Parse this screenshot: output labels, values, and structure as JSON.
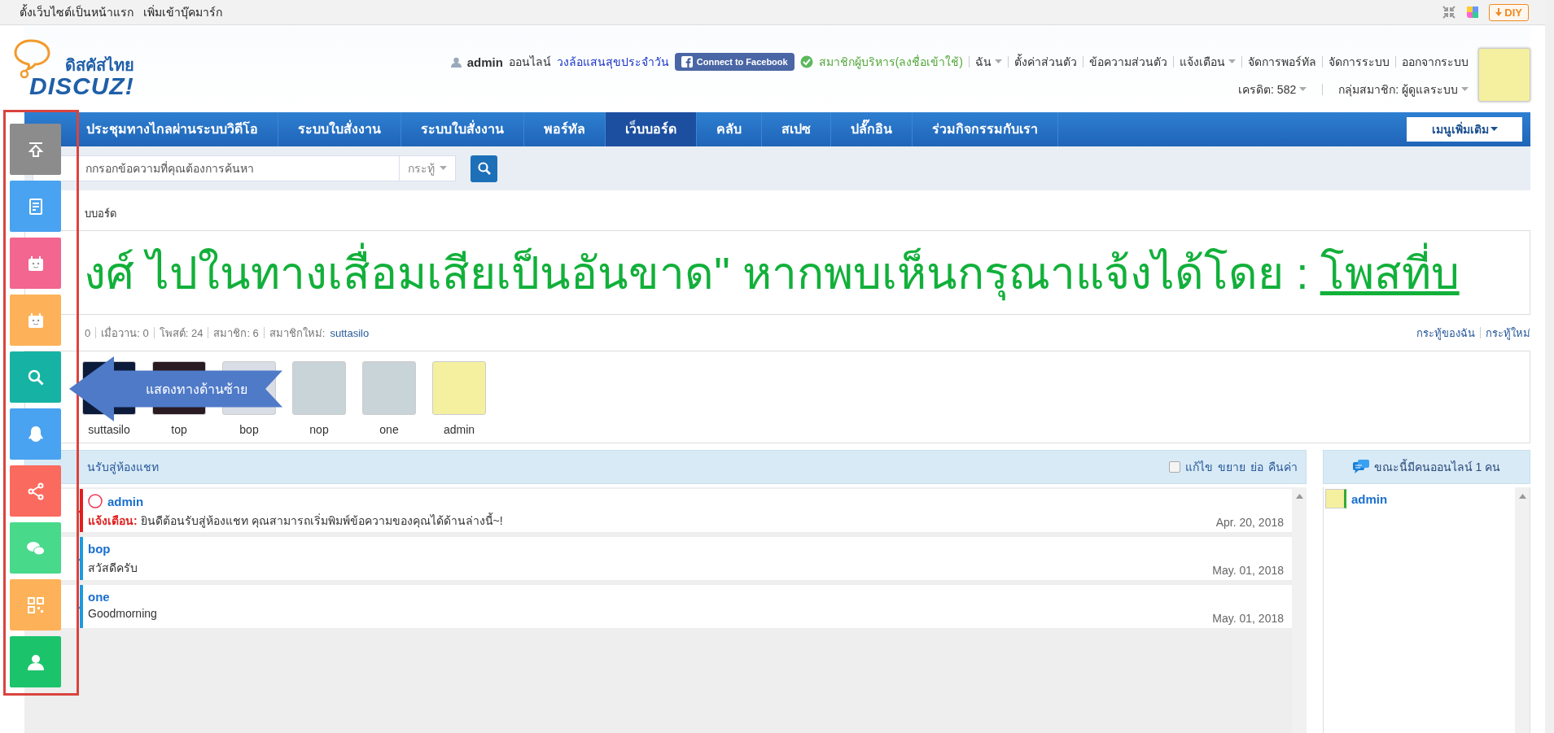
{
  "top_bar": {
    "links": [
      "ตั้งเว็บไซต์เป็นหน้าแรก",
      "เพิ่มเข้าบุ๊คมาร์ก"
    ],
    "diy_button": "DIY"
  },
  "header": {
    "logo_subtitle": "ดิสคัสไทย",
    "logo_brand": "DISCUZ!",
    "user": "admin",
    "online_status": "ออนไลน์",
    "daily_link": "วงล้อแสนสุขประจำวัน",
    "facebook_button": "Connect to Facebook",
    "member_status": "สมาชิกผู้บริหาร(ลงชื่อเข้าใช้)",
    "user_links": [
      {
        "label": "ฉัน",
        "dropdown": true
      },
      {
        "label": "ตั้งค่าส่วนตัว",
        "dropdown": false
      },
      {
        "label": "ข้อความส่วนตัว",
        "dropdown": false
      },
      {
        "label": "แจ้งเตือน",
        "dropdown": true
      },
      {
        "label": "จัดการพอร์ทัล",
        "dropdown": false
      },
      {
        "label": "จัดการระบบ",
        "dropdown": false
      },
      {
        "label": "ออกจากระบบ",
        "dropdown": false
      }
    ],
    "credit": "เครดิต: 582",
    "group": "กลุ่มสมาชิก: ผู้ดูแลระบบ"
  },
  "nav": {
    "items": [
      {
        "label": "ประชุมทางไกลผ่านระบบวิดีโอ",
        "selected": false
      },
      {
        "label": "ระบบใบสั่งงาน",
        "selected": false
      },
      {
        "label": "ระบบใบสั่งงาน",
        "selected": false
      },
      {
        "label": "พอร์ทัล",
        "selected": false
      },
      {
        "label": "เว็บบอร์ด",
        "selected": true
      },
      {
        "label": "คลับ",
        "selected": false
      },
      {
        "label": "สเปซ",
        "selected": false
      },
      {
        "label": "ปลั๊กอิน",
        "selected": false
      },
      {
        "label": "ร่วมกิจกรรมกับเรา",
        "selected": false
      }
    ],
    "more_menu": "เมนูเพิ่มเติม"
  },
  "search": {
    "placeholder": "กกรอกข้อความที่คุณต้องการค้นหา",
    "scope": "กระทู้"
  },
  "breadcrumb": "บบอร์ด",
  "notice": {
    "text": "งศ์ ไปในทางเสื่อมเสียเป็นอันขาด\" หากพบเห็นกรุณาแจ้งได้โดย :",
    "link": "โพสที่บ"
  },
  "stats": {
    "items": [
      "0",
      "เมื่อวาน: 0",
      "โพสต์: 24",
      "สมาชิก: 6"
    ],
    "new_member_label": "สมาชิกใหม่:",
    "new_member": "suttasilo",
    "links": [
      "กระทู้ของฉัน",
      "กระทู้ใหม่"
    ]
  },
  "members": [
    {
      "name": "suttasilo"
    },
    {
      "name": "top"
    },
    {
      "name": "bop"
    },
    {
      "name": "nop"
    },
    {
      "name": "one"
    },
    {
      "name": "admin"
    }
  ],
  "chat": {
    "title": "นรับสู่ห้องแชท",
    "edit_checked": false,
    "edit_label": "แก้ไข",
    "actions": [
      "ขยาย",
      "ย่อ",
      "คืนค่า"
    ],
    "messages": [
      {
        "kind": "system",
        "user": "admin",
        "color": "#e02020",
        "label": "แจ้งเตือน:",
        "text": "ยินดีต้อนรับสู่ห้องแชท คุณสามารถเริ่มพิมพ์ข้อความของคุณได้ด้านล่างนี้~!",
        "date": "Apr. 20, 2018"
      },
      {
        "kind": "user",
        "user": "bop",
        "color": "#1a9be0",
        "text": "สวัสดีครับ",
        "date": "May. 01, 2018"
      },
      {
        "kind": "user",
        "user": "one",
        "color": "#1a9be0",
        "text": "Goodmorning",
        "date": "May. 01, 2018"
      }
    ]
  },
  "online": {
    "title": "ขณะนี้มีคนออนไลน์ 1 คน",
    "users": [
      "admin"
    ]
  },
  "float_bar": [
    {
      "kind": "top",
      "color": "#8c8c8c"
    },
    {
      "kind": "post",
      "color": "#4aa3f0"
    },
    {
      "kind": "calendar",
      "color": "#f2668f"
    },
    {
      "kind": "calendar",
      "color": "#fdb25a"
    },
    {
      "kind": "search",
      "color": "#16b3a5"
    },
    {
      "kind": "penguin",
      "color": "#4aa3f0"
    },
    {
      "kind": "share",
      "color": "#fb6a5e"
    },
    {
      "kind": "chat",
      "color": "#48d98a"
    },
    {
      "kind": "qr",
      "color": "#fdb25a"
    },
    {
      "kind": "person",
      "color": "#1bc46b"
    }
  ],
  "callout": "แสดงทางด้านซ้าย"
}
